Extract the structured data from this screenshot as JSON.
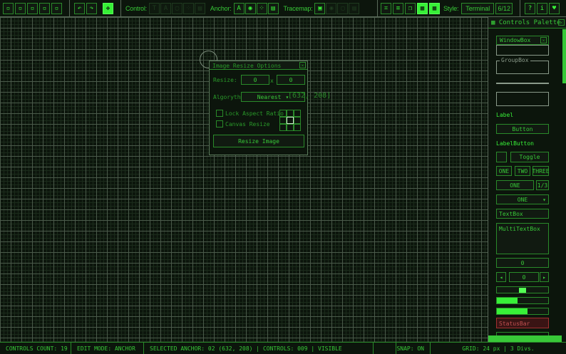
{
  "toolbar": {
    "file_icons": [
      "new-file-icon",
      "load-file-icon",
      "save-file-icon",
      "save-as-icon",
      "export-icon"
    ],
    "undo": "↶",
    "redo": "↷",
    "snap": "✥",
    "control_label": "Control:",
    "anchor_label": "Anchor:",
    "tracemap_label": "Tracemap:",
    "style_label": "Style:",
    "style_value": "Terminal",
    "style_index": "6/12",
    "help": "?",
    "info": "i",
    "heart": "♥"
  },
  "dialog": {
    "title": "Image Resize Options",
    "resize_label": "Resize:",
    "width": "0",
    "x": "x",
    "height": "0",
    "algorithm_label": "Algorythm:",
    "algorithm_value": "Nearest",
    "lock_aspect": "Lock Aspect Ratio",
    "canvas_resize": "Canvas Resize",
    "button": "Resize Image",
    "close": "×"
  },
  "cursor_coords": "[632, 208]",
  "palette": {
    "title": "Controls Palette",
    "windowbox": "WindowBox",
    "groupbox": "GroupBox",
    "label": "Label",
    "button": "Button",
    "labelbutton": "LabelButton",
    "toggle": "Toggle",
    "toggle_group": [
      "ONE",
      "TWO",
      "THREE"
    ],
    "combo": "ONE",
    "combo_index": "1/3",
    "dropdown": "ONE",
    "textbox": "TextBox",
    "multitextbox": "MultiTextBox",
    "valuebox": "0",
    "spinner": "0",
    "statusbar": "StatusBar",
    "slider_value": 0.5,
    "sliderbar_value": 0.4,
    "progress_value": 0.6
  },
  "statusbar": {
    "count": "CONTROLS COUNT: 19",
    "mode": "EDIT MODE: ANCHOR",
    "selected": "SELECTED ANCHOR: 02  (632, 208) | CONTROLS: 009 | VISIBLE",
    "snap": "SNAP: ON",
    "grid": "GRID: 24 px | 3 Divs."
  }
}
